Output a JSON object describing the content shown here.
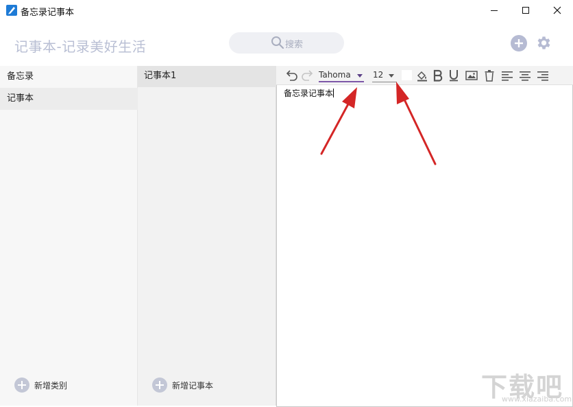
{
  "window": {
    "title": "备忘录记事本",
    "controls": [
      "minimize",
      "maximize",
      "close"
    ]
  },
  "header": {
    "brand": "记事本-记录美好生活",
    "search_placeholder": "搜索",
    "add_icon": "plus-circle-icon",
    "settings_icon": "gear-icon"
  },
  "categories": {
    "items": [
      {
        "label": "备忘录",
        "active": false
      },
      {
        "label": "记事本",
        "active": true
      }
    ],
    "add_label": "新增类别"
  },
  "notes": {
    "items": [
      {
        "label": "记事本1",
        "active": true
      }
    ],
    "add_label": "新增记事本"
  },
  "toolbar": {
    "font_family": "Tahoma",
    "font_size": "12",
    "text_color": "#ffffff",
    "icons": [
      "undo-icon",
      "redo-icon",
      "fill-color-icon",
      "bold-icon",
      "underline-icon",
      "image-icon",
      "trash-icon",
      "align-left-icon",
      "align-center-icon",
      "align-right-icon"
    ]
  },
  "editor": {
    "text": "备忘录记事本"
  },
  "watermark": {
    "big": "下载吧",
    "small": "www.xiazaiba.com"
  },
  "colors": {
    "accent": "#7c57a8",
    "brand_text": "#b9bfd4",
    "annotation_arrow": "#d42626"
  }
}
